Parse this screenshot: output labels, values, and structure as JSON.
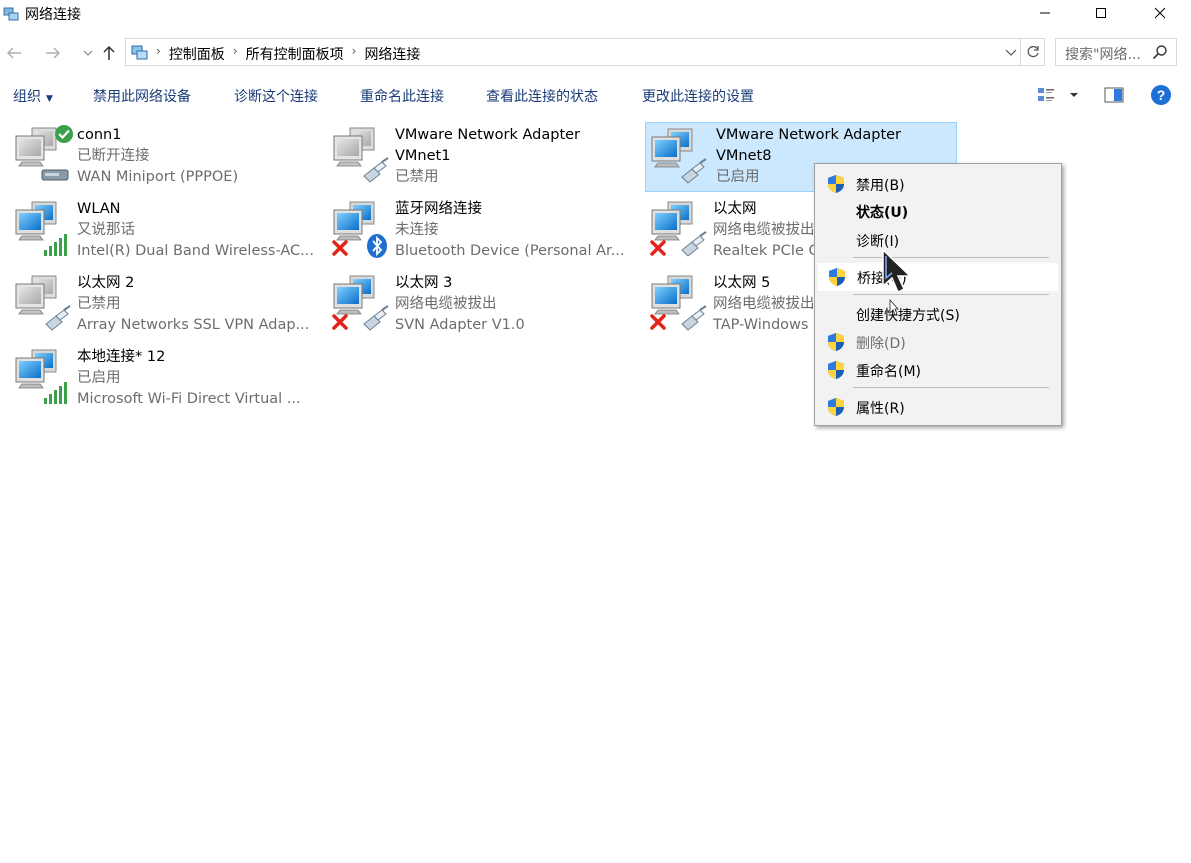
{
  "window": {
    "title": "网络连接",
    "icon": "network-connections-icon"
  },
  "address": {
    "breadcrumbs": [
      "控制面板",
      "所有控制面板项",
      "网络连接"
    ],
    "search_placeholder": "搜索\"网络..."
  },
  "toolbar": {
    "organize": "组织",
    "disable_device": "禁用此网络设备",
    "diagnose": "诊断这个连接",
    "rename": "重命名此连接",
    "view_status": "查看此连接的状态",
    "change_settings": "更改此连接的设置"
  },
  "connections": [
    {
      "name": "conn1",
      "name2": "",
      "status": "已断开连接",
      "device": "WAN Miniport (PPPOE)",
      "icon": "dialup-connected-icon"
    },
    {
      "name": "VMware Network Adapter",
      "name2": "VMnet1",
      "status": "已禁用",
      "device": "",
      "icon": "ethernet-disabled-icon"
    },
    {
      "name": "VMware Network Adapter",
      "name2": "VMnet8",
      "status": "已启用",
      "device": "",
      "icon": "ethernet-enabled-icon"
    },
    {
      "name": "WLAN",
      "name2": "",
      "status": "又说那话",
      "device": "Intel(R) Dual Band Wireless-AC...",
      "icon": "wifi-icon"
    },
    {
      "name": "蓝牙网络连接",
      "name2": "",
      "status": "未连接",
      "device": "Bluetooth Device (Personal Ar...",
      "icon": "bluetooth-icon"
    },
    {
      "name": "以太网",
      "name2": "",
      "status": "网络电缆被拔出",
      "device": "Realtek PCIe G",
      "icon": "ethernet-unplugged-icon"
    },
    {
      "name": "以太网 2",
      "name2": "",
      "status": "已禁用",
      "device": "Array Networks SSL VPN Adap...",
      "icon": "ethernet-disabled-icon"
    },
    {
      "name": "以太网 3",
      "name2": "",
      "status": "网络电缆被拔出",
      "device": "SVN Adapter V1.0",
      "icon": "ethernet-unplugged-icon"
    },
    {
      "name": "以太网 5",
      "name2": "",
      "status": "网络电缆被拔出",
      "device": "TAP-Windows",
      "icon": "ethernet-unplugged-icon"
    },
    {
      "name": "本地连接* 12",
      "name2": "",
      "status": "已启用",
      "device": "Microsoft Wi-Fi Direct Virtual ...",
      "icon": "wifi-icon"
    }
  ],
  "context_menu": {
    "disable": "禁用(B)",
    "status": "状态(U)",
    "diagnose": "诊断(I)",
    "bridge": "桥接(G)",
    "shortcut": "创建快捷方式(S)",
    "delete": "删除(D)",
    "rename": "重命名(M)",
    "properties": "属性(R)"
  },
  "colors": {
    "selection": "#cce8ff",
    "command_text": "#1a3b78",
    "help_blue": "#1c6fd6"
  }
}
